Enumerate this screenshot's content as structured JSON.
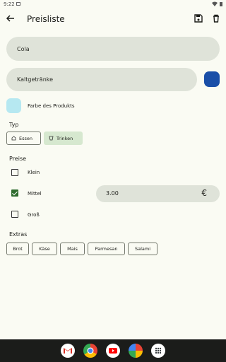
{
  "status": {
    "time": "9:22",
    "small_icon": "notification-icon"
  },
  "app_bar": {
    "title": "Preisliste",
    "back_icon": "arrow-back-icon",
    "save_icon": "save-icon",
    "delete_icon": "delete-icon"
  },
  "form": {
    "name_value": "Cola",
    "category_value": "Kaltgetränke",
    "category_color": "#1a4fa8",
    "product_color_label": "Farbe des Produkts",
    "product_color": "#b6e8f1"
  },
  "type": {
    "label": "Typ",
    "options": [
      {
        "label": "Essen",
        "icon": "food-icon",
        "selected": false
      },
      {
        "label": "Trinken",
        "icon": "drink-icon",
        "selected": true
      }
    ]
  },
  "prices": {
    "label": "Preise",
    "items": [
      {
        "label": "Klein",
        "checked": false
      },
      {
        "label": "Mittel",
        "checked": true,
        "value": "3.00",
        "currency": "€"
      },
      {
        "label": "Groß",
        "checked": false
      }
    ]
  },
  "extras": {
    "label": "Extras",
    "items": [
      "Brot",
      "Käse",
      "Mais",
      "Parmesan",
      "Salami"
    ]
  },
  "dock": [
    "gmail-icon",
    "chrome-icon",
    "youtube-icon",
    "photos-icon",
    "apps-icon"
  ]
}
